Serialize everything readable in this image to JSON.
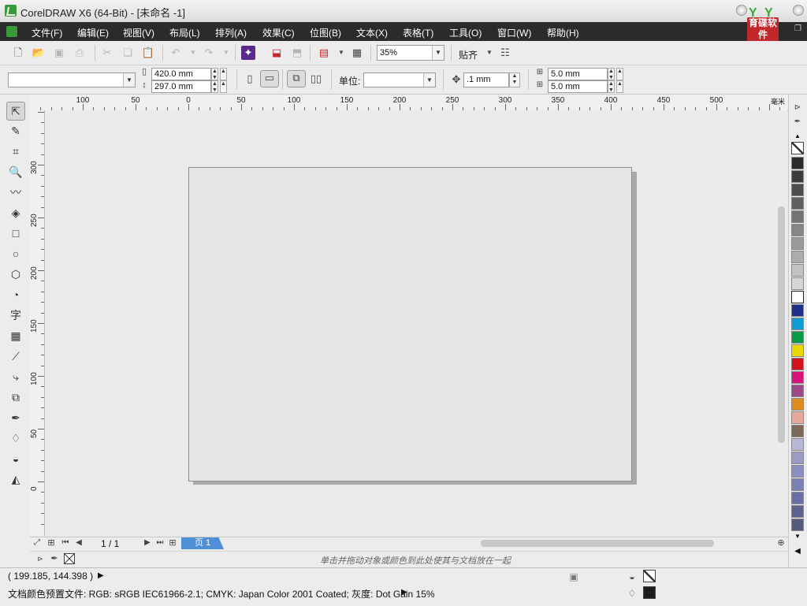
{
  "window": {
    "title": "CorelDRAW X6 (64-Bit) - [未命名 -1]"
  },
  "logo": {
    "text": "育碟软件",
    "brand_color": "#c0282c"
  },
  "menu": {
    "items": [
      {
        "label": "文件(F)"
      },
      {
        "label": "编辑(E)"
      },
      {
        "label": "视图(V)"
      },
      {
        "label": "布局(L)"
      },
      {
        "label": "排列(A)"
      },
      {
        "label": "效果(C)"
      },
      {
        "label": "位图(B)"
      },
      {
        "label": "文本(X)"
      },
      {
        "label": "表格(T)"
      },
      {
        "label": "工具(O)"
      },
      {
        "label": "窗口(W)"
      },
      {
        "label": "帮助(H)"
      }
    ]
  },
  "standard_toolbar": {
    "zoom_value": "35%",
    "snap_label": "贴齐",
    "icons": [
      "new-icon",
      "open-icon",
      "save-icon",
      "print-icon",
      "cut-icon",
      "copy-icon",
      "paste-icon",
      "undo-icon",
      "redo-icon",
      "search-content-icon",
      "import-icon",
      "export-icon",
      "application-launcher-icon",
      "welcome-screen-icon",
      "options-icon"
    ]
  },
  "property_bar": {
    "paper_preset": "",
    "width": "420.0 mm",
    "height": "297.0 mm",
    "units_label": "单位:",
    "units_value": "",
    "nudge": ".1 mm",
    "dup_x": "5.0 mm",
    "dup_y": "5.0 mm"
  },
  "toolbox": {
    "tools": [
      "pick-tool-icon",
      "shape-tool-icon",
      "crop-tool-icon",
      "zoom-tool-icon",
      "freehand-tool-icon",
      "smart-fill-icon",
      "rectangle-tool-icon",
      "ellipse-tool-icon",
      "polygon-tool-icon",
      "basic-shapes-icon",
      "text-tool-icon",
      "table-tool-icon",
      "dimension-tool-icon",
      "connector-tool-icon",
      "blend-tool-icon",
      "eyedropper-tool-icon",
      "outline-pen-icon",
      "fill-tool-icon",
      "interactive-fill-icon"
    ],
    "text_tool_glyph": "字"
  },
  "ruler": {
    "horizontal_labels": [
      "100",
      "50",
      "0",
      "50",
      "100",
      "150",
      "200",
      "250",
      "300",
      "350",
      "400",
      "450",
      "500"
    ],
    "unit": "毫米",
    "vertical_labels": [
      "300",
      "250",
      "200",
      "150",
      "100",
      "50",
      "0"
    ]
  },
  "pages": {
    "counter": "1 / 1",
    "tab_label": "页 1"
  },
  "hint": "单击并拖动对象或颜色到此处使其与文档放在一起",
  "palette": {
    "colors": [
      "#2b2b2b",
      "#3c3c3c",
      "#4d4d4d",
      "#606060",
      "#737373",
      "#868686",
      "#9a9a9a",
      "#adadad",
      "#c2c2c2",
      "#d6d6d6",
      "#ffffff",
      "#1f2f8a",
      "#0f9ad8",
      "#0a9a4a",
      "#e6d800",
      "#d2141e",
      "#d8147a",
      "#9a4b86",
      "#e08b1e",
      "#e8a89a",
      "#7d6b5a",
      "#b9b7d6",
      "#9d9bc6",
      "#8a90c2",
      "#7a7fb6",
      "#6a6fa6",
      "#5f638f",
      "#555a7f"
    ]
  },
  "status": {
    "coords": "( 199.185, 144.398 )",
    "profile": "文档颜色预置文件: RGB: sRGB IEC61966-2.1; CMYK: Japan Color 2001 Coated; 灰度: Dot Gain 15%"
  }
}
